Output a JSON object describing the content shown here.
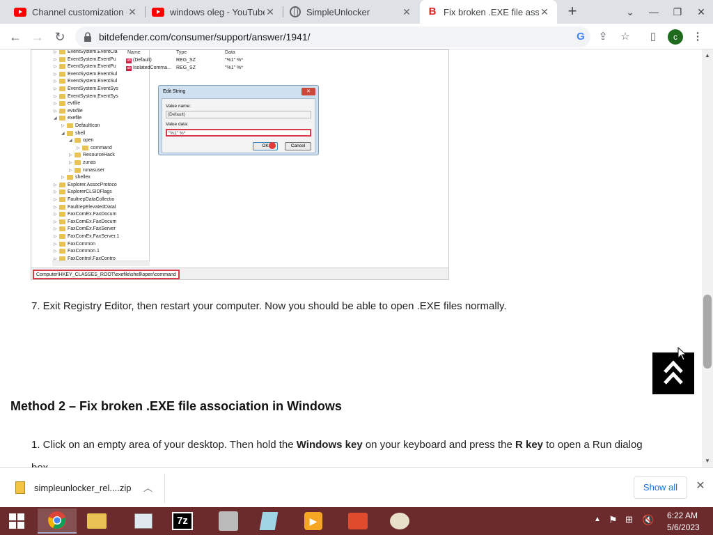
{
  "browser": {
    "tabs": [
      {
        "title": "Channel customization -",
        "icon": "youtube-icon"
      },
      {
        "title": "windows oleg - YouTube",
        "icon": "youtube-icon"
      },
      {
        "title": "SimpleUnlocker",
        "icon": "globe-icon"
      },
      {
        "title": "Fix broken .EXE file assoc",
        "icon": "bitdefender-icon",
        "active": true
      }
    ],
    "url": "bitdefender.com/consumer/support/answer/1941/",
    "profile_initial": "c"
  },
  "registry": {
    "tree_items": [
      "EventSystem.EventCla",
      "EventSystem.EventPu",
      "EventSystem.EventPu",
      "EventSystem.EventSul",
      "EventSystem.EventSul",
      "EventSystem.EventSys",
      "EventSystem.EventSys",
      "evtfile",
      "evtxfile",
      "exefile",
      "DefaultIcon",
      "shell",
      "open",
      "command",
      "ResourceHack",
      "zunas",
      "runasuser",
      "shellex",
      "Explorer.AssocProtoco",
      "ExplorerCLSIDFlags",
      "FaultrepDataCollectio",
      "FaultrepElevatedDatal",
      "FaxComEx.FaxDocum",
      "FaxComEx.FaxDocum",
      "FaxComEx.FaxServer",
      "FaxComEx.FaxServer.1",
      "FaxCommon",
      "FaxCommon.1",
      "FaxControl.FaxContro"
    ],
    "columns": {
      "name": "Name",
      "type": "Type",
      "data": "Data"
    },
    "values": [
      {
        "name": "(Default)",
        "type": "REG_SZ",
        "data": "\"%1\" %*"
      },
      {
        "name": "IsolatedComma...",
        "type": "REG_SZ",
        "data": "\"%1\" %*"
      }
    ],
    "status_path": "Computer\\HKEY_CLASSES_ROOT\\exefile\\shell\\open\\command",
    "dialog": {
      "title": "Edit String",
      "value_name_label": "Value name:",
      "value_name": "(Default)",
      "value_data_label": "Value data:",
      "value_data": "\"%1\" %*",
      "ok": "OK",
      "cancel": "Cancel"
    }
  },
  "article": {
    "step7": "7. Exit Registry Editor, then restart your computer. Now you should be able to open .EXE files normally.",
    "method2_title": "Method 2 – Fix broken .EXE file association in Windows",
    "step1_a": "1. Click on an empty area of your desktop. Then hold the ",
    "step1_b": "Windows key",
    "step1_c": " on your keyboard and press the ",
    "step1_d": "R key",
    "step1_e": " to open a Run dialog",
    "step1_cont": "box."
  },
  "download_bar": {
    "filename": "simpleunlocker_rel....zip",
    "show_all": "Show all"
  },
  "taskbar": {
    "time": "6:22 AM",
    "date": "5/6/2023"
  }
}
